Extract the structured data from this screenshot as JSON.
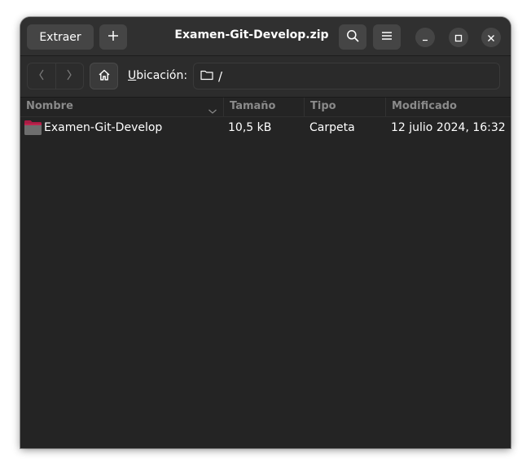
{
  "window": {
    "title": "Examen-Git-Develop.zip"
  },
  "headerbar": {
    "extract_label": "Extraer",
    "add_icon": "plus-icon",
    "search_icon": "search-icon",
    "menu_icon": "hamburger-menu-icon",
    "minimize_icon": "minimize-icon",
    "maximize_icon": "maximize-icon",
    "close_icon": "close-icon"
  },
  "toolbar": {
    "back_icon": "chevron-left-icon",
    "forward_icon": "chevron-right-icon",
    "home_icon": "home-icon",
    "location_label_accel": "U",
    "location_label_rest": "bicación:",
    "location_path": "/"
  },
  "columns": {
    "name": "Nombre",
    "size": "Tamaño",
    "type": "Tipo",
    "modified": "Modificado"
  },
  "rows": [
    {
      "name": "Examen-Git-Develop",
      "size": "10,5 kB",
      "type": "Carpeta",
      "modified": "12 julio 2024, 16:32",
      "icon": "folder-icon"
    }
  ],
  "colors": {
    "window_bg": "#242424",
    "headerbar_bg": "#303030",
    "button_bg": "#454545",
    "folder_color": "#c0244e"
  }
}
